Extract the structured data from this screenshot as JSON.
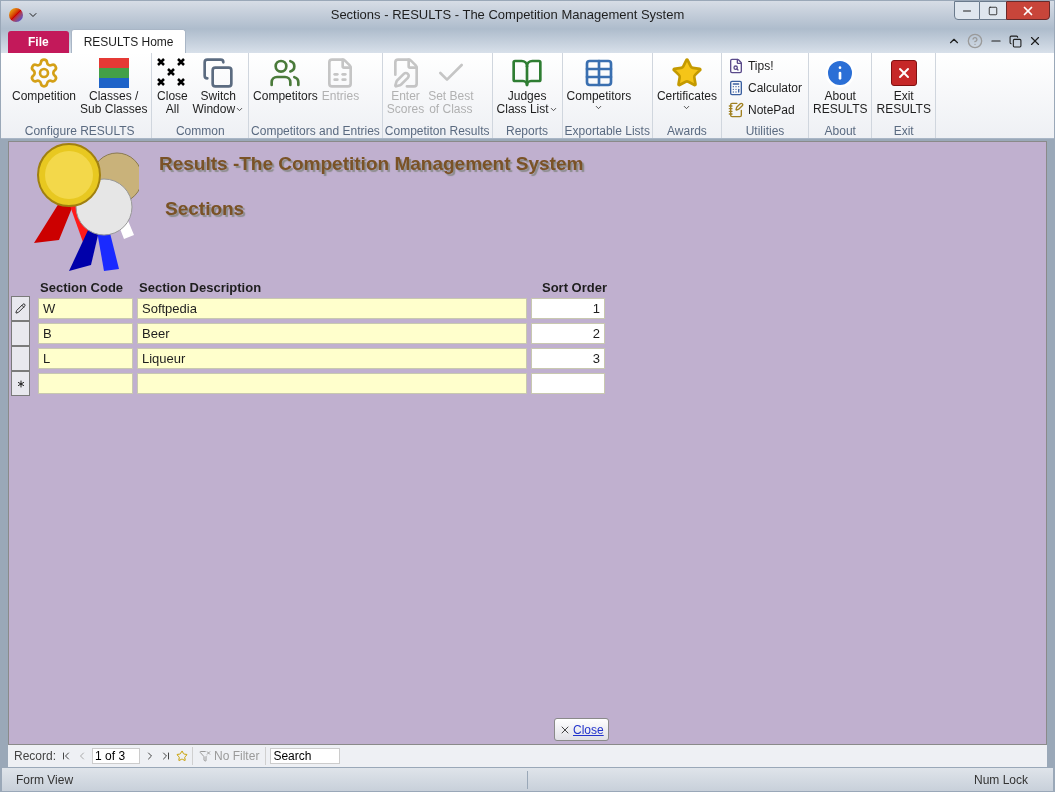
{
  "window": {
    "title": "Sections - RESULTS - The Competition Management System"
  },
  "tabs": [
    {
      "label": "File",
      "kind": "file",
      "selected": false
    },
    {
      "label": "RESULTS Home",
      "kind": "ribbon",
      "selected": true
    }
  ],
  "ribbon": [
    {
      "label": "Configure RESULTS",
      "buttons": [
        {
          "kind": "large",
          "lines": [
            "Competition"
          ],
          "disabled": false,
          "dropdown": false
        },
        {
          "kind": "large",
          "lines": [
            "Classes /",
            "Sub Classes"
          ],
          "disabled": false,
          "dropdown": false
        }
      ]
    },
    {
      "label": "Common",
      "buttons": [
        {
          "kind": "large",
          "lines": [
            "Close",
            "All"
          ],
          "disabled": false,
          "dropdown": false
        },
        {
          "kind": "large",
          "lines": [
            "Switch",
            "Window"
          ],
          "disabled": false,
          "dropdown": true
        }
      ]
    },
    {
      "label": "Competitors and Entries",
      "buttons": [
        {
          "kind": "large",
          "lines": [
            "Competitors"
          ],
          "disabled": false,
          "dropdown": false
        },
        {
          "kind": "large",
          "lines": [
            "Entries"
          ],
          "disabled": true,
          "dropdown": false
        }
      ]
    },
    {
      "label": "Competiton Results",
      "buttons": [
        {
          "kind": "large",
          "lines": [
            "Enter",
            "Scores"
          ],
          "disabled": true,
          "dropdown": false
        },
        {
          "kind": "large",
          "lines": [
            "Set Best",
            "of Class"
          ],
          "disabled": true,
          "dropdown": false
        }
      ]
    },
    {
      "label": "Reports",
      "buttons": [
        {
          "kind": "large",
          "lines": [
            "Judges",
            "Class List"
          ],
          "disabled": false,
          "dropdown": true
        }
      ]
    },
    {
      "label": "Exportable Lists",
      "buttons": [
        {
          "kind": "large",
          "lines": [
            "Competitors"
          ],
          "disabled": false,
          "dropdown": true
        }
      ]
    },
    {
      "label": "Awards",
      "buttons": [
        {
          "kind": "large",
          "lines": [
            "Certificates"
          ],
          "disabled": false,
          "dropdown": true
        }
      ]
    },
    {
      "label": "Utilities",
      "buttons": [
        {
          "kind": "small",
          "lines": [
            "Tips!"
          ],
          "disabled": false
        },
        {
          "kind": "small",
          "lines": [
            "Calculator"
          ],
          "disabled": false
        },
        {
          "kind": "small",
          "lines": [
            "NotePad"
          ],
          "disabled": false
        }
      ]
    },
    {
      "label": "About",
      "buttons": [
        {
          "kind": "large",
          "lines": [
            "About",
            "RESULTS"
          ],
          "disabled": false,
          "dropdown": false
        }
      ]
    },
    {
      "label": "Exit",
      "buttons": [
        {
          "kind": "large",
          "lines": [
            "Exit",
            "RESULTS"
          ],
          "disabled": false,
          "dropdown": false
        }
      ]
    }
  ],
  "form": {
    "title": "Results -The Competition Management System",
    "subtitle": "Sections",
    "columns": [
      "Section Code",
      "Section Description",
      "Sort Order"
    ],
    "rows": [
      {
        "kind": "record",
        "editing": true,
        "code": "W",
        "description": "Softpedia",
        "sort_order": "1"
      },
      {
        "kind": "record",
        "editing": false,
        "code": "B",
        "description": "Beer",
        "sort_order": "2"
      },
      {
        "kind": "record",
        "editing": false,
        "code": "L",
        "description": "Liqueur",
        "sort_order": "3"
      },
      {
        "kind": "new",
        "editing": false
      }
    ],
    "close_button": "Close"
  },
  "record_nav": {
    "label": "Record:",
    "position": "1 of 3",
    "filter": {
      "label": "No Filter",
      "disabled": true
    },
    "search": {
      "placeholder": "Search"
    }
  },
  "status_bar": {
    "left": "Form View",
    "right": "Num Lock"
  }
}
